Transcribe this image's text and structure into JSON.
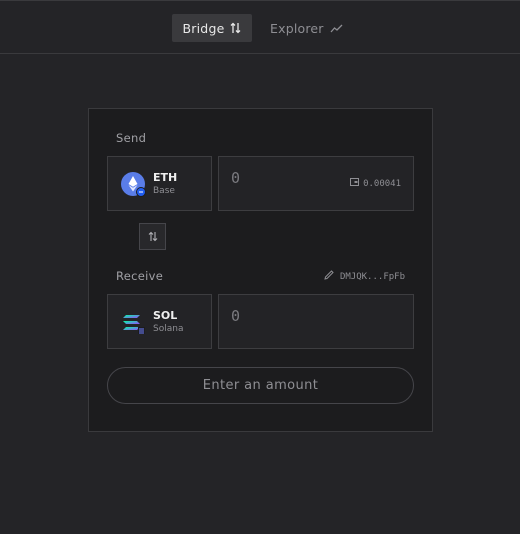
{
  "nav": {
    "tabs": [
      {
        "label": "Bridge",
        "icon": "swap-vertical-icon",
        "active": true
      },
      {
        "label": "Explorer",
        "icon": "trend-line-icon",
        "active": false
      }
    ]
  },
  "send": {
    "label": "Send",
    "token": {
      "symbol": "ETH",
      "chain": "Base",
      "icon": "ethereum-icon",
      "badge": "base-chain-icon"
    },
    "amount_placeholder": "0",
    "balance": "0.00041",
    "balance_icon": "wallet-icon"
  },
  "swap_icon": "swap-vertical-icon",
  "receive": {
    "label": "Receive",
    "wallet_address": "DMJQK...FpFb",
    "wallet_icon": "pencil-icon",
    "token": {
      "symbol": "SOL",
      "chain": "Solana",
      "icon": "solana-icon"
    },
    "amount_placeholder": "0"
  },
  "cta_label": "Enter an amount",
  "colors": {
    "background": "#242427",
    "card": "#1c1c1e",
    "eth_blue": "#5a7de8",
    "base_blue": "#1f5cf0",
    "solana_gradient": [
      "#00ffa3",
      "#9945ff"
    ]
  }
}
